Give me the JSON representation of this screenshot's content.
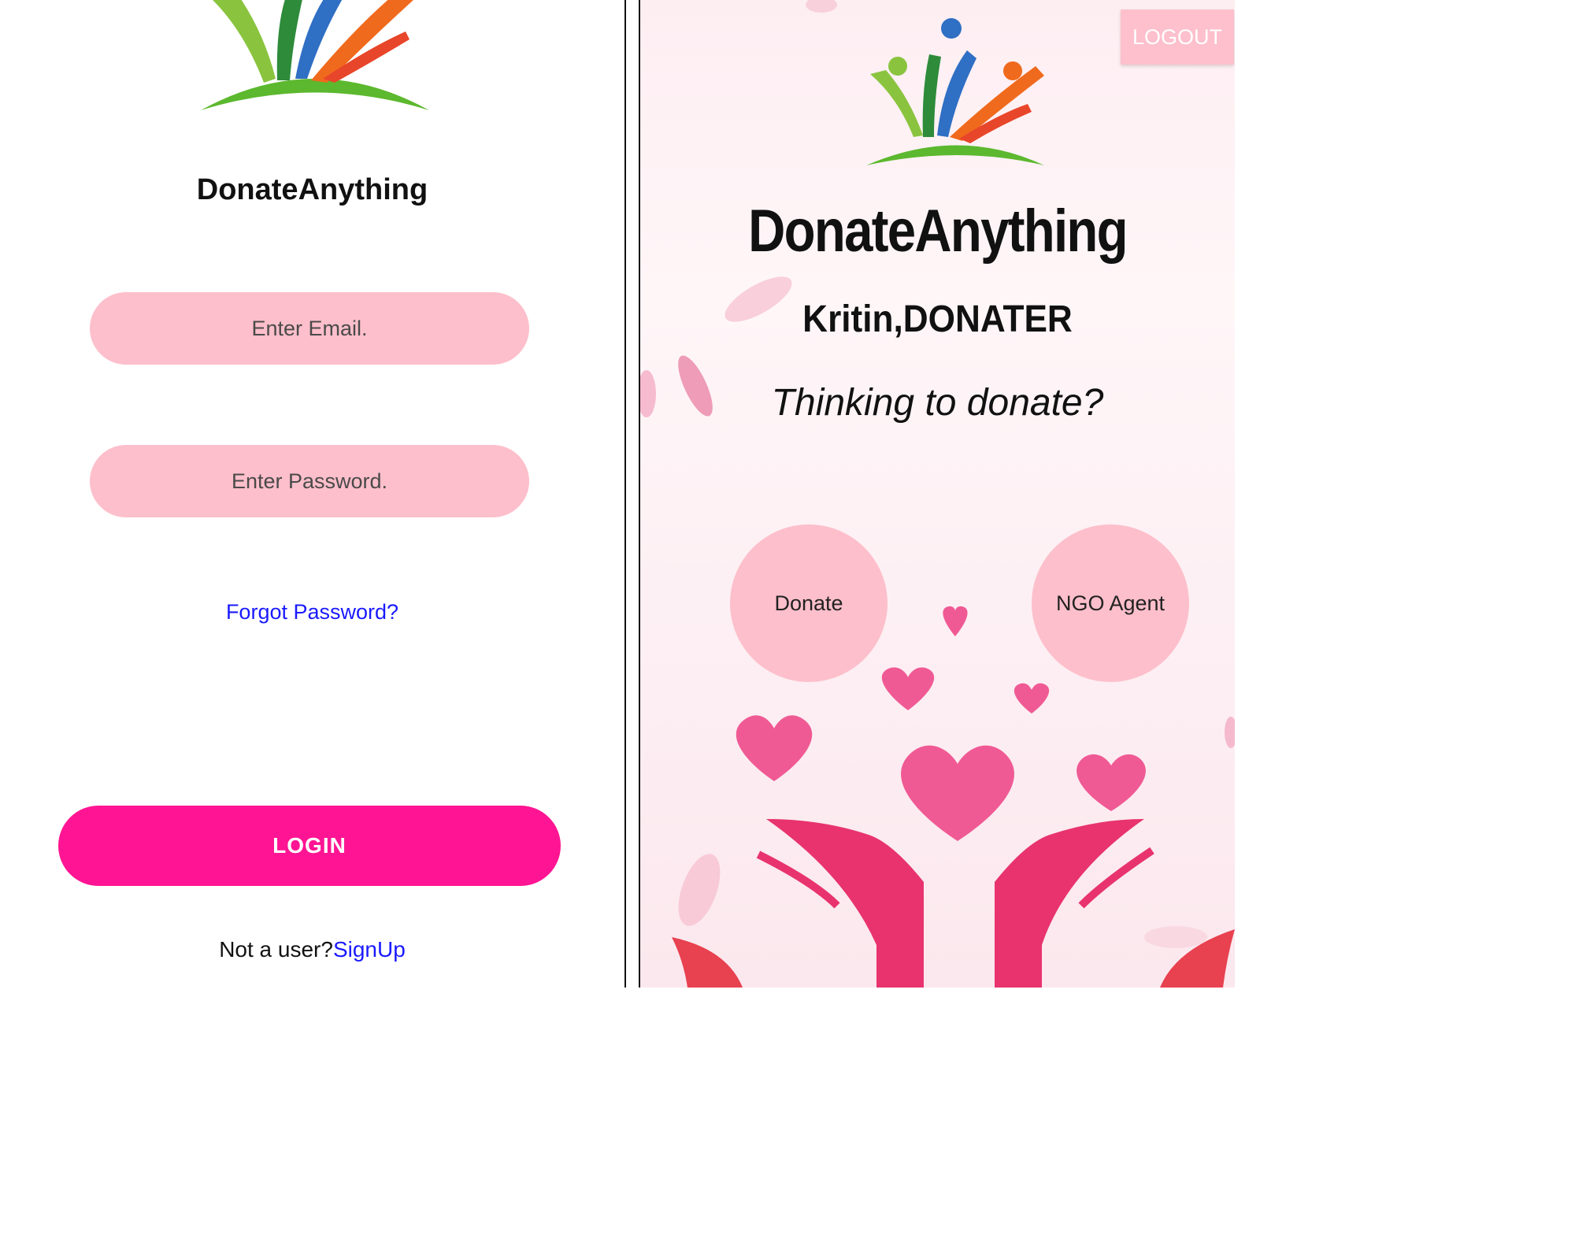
{
  "login_screen": {
    "app_title": "DonateAnything",
    "email_placeholder": "Enter Email.",
    "password_placeholder": "Enter Password.",
    "forgot_password_label": "Forgot Password?",
    "login_label": "LOGIN",
    "signup_prompt": "Not a user?",
    "signup_label": "SignUp"
  },
  "home_screen": {
    "logout_label": "LOGOUT",
    "app_title": "DonateAnything",
    "greeting": "Kritin,DONATER",
    "tagline": "Thinking to donate?",
    "donate_label": "Donate",
    "ngo_agent_label": "NGO Agent"
  },
  "colors": {
    "accent_pink": "#ff1593",
    "field_pink": "#fdbfcb",
    "link_blue": "#1a1aff",
    "heart_pink": "#f05a94"
  },
  "icons": {
    "logo": "people-celebrating-logo-icon",
    "illustration": "hands-with-hearts-icon"
  }
}
